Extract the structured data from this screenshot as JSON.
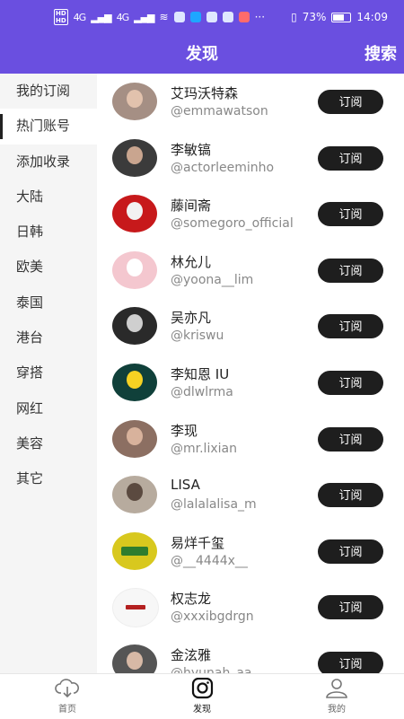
{
  "statusbar": {
    "signal_left": "4G",
    "signal_right": "4G",
    "battery": "73%",
    "time": "14:09",
    "more": "···"
  },
  "header": {
    "title": "发现",
    "search_label": "搜索",
    "accent_color": "#6a4fe0"
  },
  "sidebar": {
    "items": [
      {
        "label": "我的订阅"
      },
      {
        "label": "热门账号",
        "active": true
      },
      {
        "label": "添加收录"
      },
      {
        "label": "大陆"
      },
      {
        "label": "日韩"
      },
      {
        "label": "欧美"
      },
      {
        "label": "泰国"
      },
      {
        "label": "港台"
      },
      {
        "label": "穿搭"
      },
      {
        "label": "网红"
      },
      {
        "label": "美容"
      },
      {
        "label": "其它"
      }
    ]
  },
  "accounts": [
    {
      "name": "艾玛沃特森",
      "handle": "@emmawatson",
      "button": "订阅"
    },
    {
      "name": "李敏镐",
      "handle": "@actorleeminho",
      "button": "订阅"
    },
    {
      "name": "藤间斋",
      "handle": "@somegoro_official",
      "button": "订阅"
    },
    {
      "name": "林允儿",
      "handle": "@yoona__lim",
      "button": "订阅"
    },
    {
      "name": "吴亦凡",
      "handle": "@kriswu",
      "button": "订阅"
    },
    {
      "name": "李知恩 IU",
      "handle": "@dlwlrma",
      "button": "订阅"
    },
    {
      "name": "李现",
      "handle": "@mr.lixian",
      "button": "订阅"
    },
    {
      "name": "LISA",
      "handle": "@lalalalisa_m",
      "button": "订阅"
    },
    {
      "name": "易烊千玺",
      "handle": "@__4444x__",
      "button": "订阅"
    },
    {
      "name": "权志龙",
      "handle": "@xxxibgdrgn",
      "button": "订阅"
    },
    {
      "name": "金泫雅",
      "handle": "@hyunah_aa",
      "button": "订阅"
    }
  ],
  "bottom_nav": {
    "items": [
      {
        "label": "首页",
        "icon": "cloud-download-icon"
      },
      {
        "label": "发现",
        "icon": "instagram-icon",
        "active": true
      },
      {
        "label": "我的",
        "icon": "person-icon"
      }
    ]
  }
}
